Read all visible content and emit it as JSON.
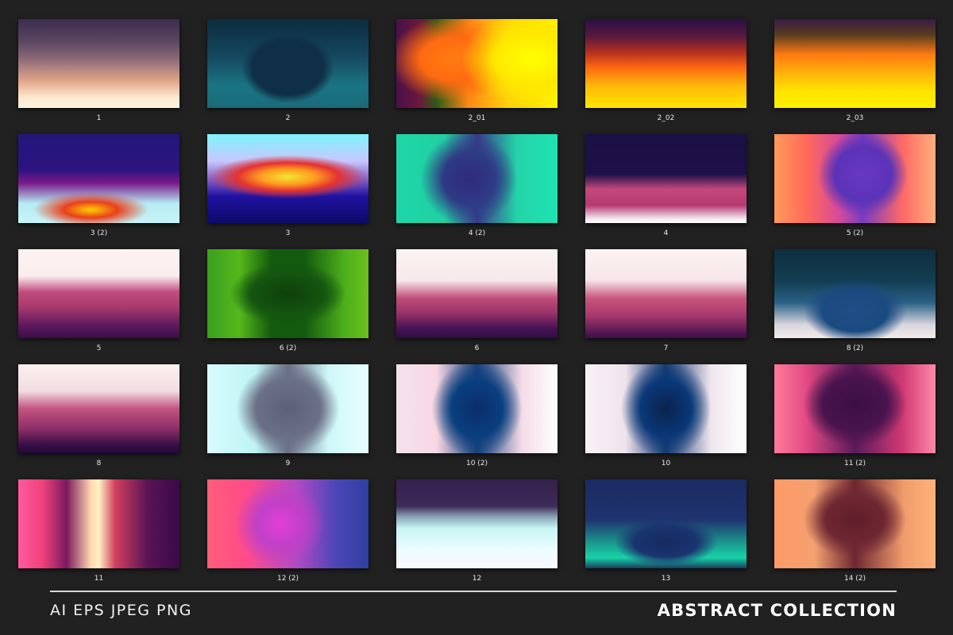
{
  "gallery": {
    "items": [
      {
        "caption": "1"
      },
      {
        "caption": "2"
      },
      {
        "caption": "2_01"
      },
      {
        "caption": "2_02"
      },
      {
        "caption": "2_03"
      },
      {
        "caption": "3 (2)"
      },
      {
        "caption": "3"
      },
      {
        "caption": "4 (2)"
      },
      {
        "caption": "4"
      },
      {
        "caption": "5 (2)"
      },
      {
        "caption": "5"
      },
      {
        "caption": "6 (2)"
      },
      {
        "caption": "6"
      },
      {
        "caption": "7"
      },
      {
        "caption": "8 (2)"
      },
      {
        "caption": "8"
      },
      {
        "caption": "9"
      },
      {
        "caption": "10 (2)"
      },
      {
        "caption": "10"
      },
      {
        "caption": "11 (2)"
      },
      {
        "caption": "11"
      },
      {
        "caption": "12 (2)"
      },
      {
        "caption": "12"
      },
      {
        "caption": "13"
      },
      {
        "caption": "14 (2)"
      }
    ]
  },
  "footer": {
    "formats": "AI EPS JPEG PNG",
    "title": "ABSTRACT COLLECTION"
  },
  "colors": {
    "background": "#212121",
    "text": "#ffffff",
    "divider": "#d8d8d8"
  }
}
